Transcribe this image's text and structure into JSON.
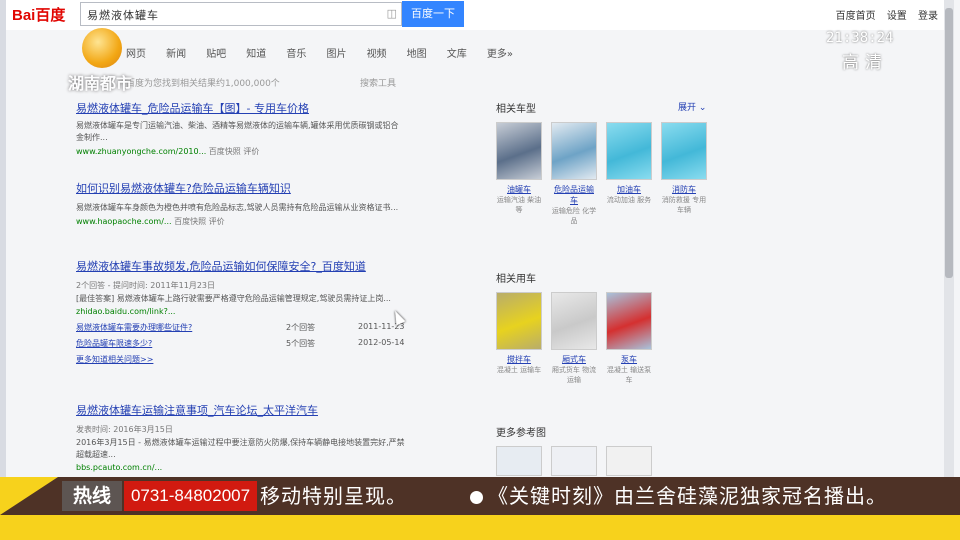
{
  "search": {
    "logo": "Bai百度",
    "query": "易燃液体罐车",
    "button_label": "百度一下",
    "top_links": [
      "百度首页",
      "设置",
      "登录"
    ]
  },
  "tabs": [
    "网页",
    "新闻",
    "贴吧",
    "知道",
    "音乐",
    "图片",
    "视频",
    "地图",
    "文库",
    "更多»"
  ],
  "result_count": "百度为您找到相关结果约1,000,000个",
  "tools_label": "搜索工具",
  "results": [
    {
      "title": "易燃液体罐车_危险品运输车【图】- 专用车价格",
      "snippet": "易燃液体罐车是专门运输汽油、柴油、酒精等易燃液体的运输车辆,罐体采用优质碳钢或铝合金制作...",
      "url": "www.zhuanyongche.com/2010...",
      "cache": "百度快照",
      "eval": "评价"
    },
    {
      "title": "如何识别易燃液体罐车?危险品运输车辆知识",
      "snippet": "易燃液体罐车车身颜色为橙色并喷有危险品标志,驾驶人员需持有危险品运输从业资格证书...",
      "url": "www.haopaoche.com/...",
      "cache": "百度快照",
      "eval": "评价"
    },
    {
      "title": "易燃液体罐车事故频发,危险品运输如何保障安全?_百度知道",
      "meta": "2个回答 - 提问时间: 2011年11月23日",
      "snippet": "[最佳答案] 易燃液体罐车上路行驶需要严格遵守危险品运输管理规定,驾驶员需持证上岗...",
      "url": "zhidao.baidu.com/link?...",
      "qa": [
        {
          "q": "易燃液体罐车需要办理哪些证件?",
          "a": "2个回答",
          "d": "2011-11-23"
        },
        {
          "q": "危险品罐车限速多少?",
          "a": "5个回答",
          "d": "2012-05-14"
        }
      ],
      "more": "更多知道相关问题>>"
    },
    {
      "title": "易燃液体罐车运输注意事项_汽车论坛_太平洋汽车",
      "meta": "发表时间: 2016年3月15日",
      "snippet": "2016年3月15日 - 易燃液体罐车运输过程中要注意防火防爆,保持车辆静电接地装置完好,严禁超载超速...",
      "url": "bbs.pcauto.com.cn/..."
    }
  ],
  "side": {
    "section1": "相关车型",
    "expand": "展开",
    "section2": "相关用车",
    "section3": "更多参考图",
    "cards1": [
      {
        "label": "油罐车",
        "sub": "运输汽油 柴油等",
        "color1": "#5b6f8a",
        "color2": "#c7cdd6"
      },
      {
        "label": "危险品运输车",
        "sub": "运输危险 化学品",
        "color1": "#6ea3c6",
        "color2": "#e2eaf1"
      },
      {
        "label": "加油车",
        "sub": "流动加油 服务",
        "color1": "#43b8d8",
        "color2": "#8adcef"
      },
      {
        "label": "消防车",
        "sub": "消防救援 专用车辆",
        "color1": "#43b8d8",
        "color2": "#8adcef"
      }
    ],
    "cards2": [
      {
        "label": "搅拌车",
        "sub": "混凝土 运输车",
        "color1": "#e7d21f",
        "color2": "#b9ad6a"
      },
      {
        "label": "厢式车",
        "sub": "厢式货车 物流运输",
        "color1": "#c9c9c9",
        "color2": "#e8e8e8"
      },
      {
        "label": "泵车",
        "sub": "混凝土 输送泵车",
        "color1": "#d43030",
        "color2": "#a8c3dc"
      }
    ]
  },
  "overlay": {
    "channel": "湖南都市",
    "time": "21:38:24",
    "hd": "高清"
  },
  "ticker": {
    "hotline_label": "热线",
    "hotline_number": "0731-84802007",
    "text1": "移动特别呈现。",
    "text2": "《关键时刻》由兰舍硅藻泥独家冠名播出。"
  }
}
